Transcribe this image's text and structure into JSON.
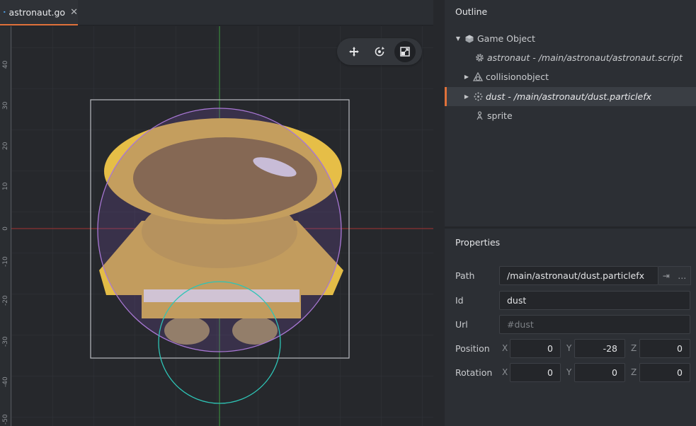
{
  "tab": {
    "label": "astronaut.go",
    "close": "✕"
  },
  "ruler": {
    "ticks": [
      "40",
      "30",
      "20",
      "10",
      "0",
      "-10",
      "-20",
      "-30",
      "-40",
      "-50"
    ]
  },
  "gizmo": {
    "tools": [
      "move-tool",
      "rotate-tool",
      "scale-tool"
    ],
    "active": "scale-tool"
  },
  "outline": {
    "title": "Outline",
    "items": [
      {
        "label": "Game Object",
        "expanded": true,
        "icon": "cube-icon"
      },
      {
        "label": "astronaut - /main/astronaut/astronaut.script",
        "icon": "gear-icon"
      },
      {
        "label": "collisionobject",
        "icon": "collision-icon"
      },
      {
        "label": "dust - /main/astronaut/dust.particlefx",
        "icon": "particle-icon",
        "selected": true
      },
      {
        "label": "sprite",
        "icon": "sprite-icon"
      }
    ]
  },
  "properties": {
    "title": "Properties",
    "path": {
      "label": "Path",
      "value": "/main/astronaut/dust.particlefx",
      "goto": "⇥",
      "more": "…"
    },
    "id": {
      "label": "Id",
      "value": "dust"
    },
    "url": {
      "label": "Url",
      "placeholder": "#dust"
    },
    "position": {
      "label": "Position",
      "x": "0",
      "y": "-28",
      "z": "0"
    },
    "rotation": {
      "label": "Rotation",
      "x": "0",
      "y": "0",
      "z": "0"
    },
    "axes": {
      "x": "X",
      "y": "Y",
      "z": "Z"
    }
  },
  "colors": {
    "accent": "#e0713a",
    "selection_circle": "#2ec4b6",
    "collision_circle": "#b07ad6",
    "x_axis": "#b83a3a",
    "y_axis": "#3c9a3c"
  }
}
